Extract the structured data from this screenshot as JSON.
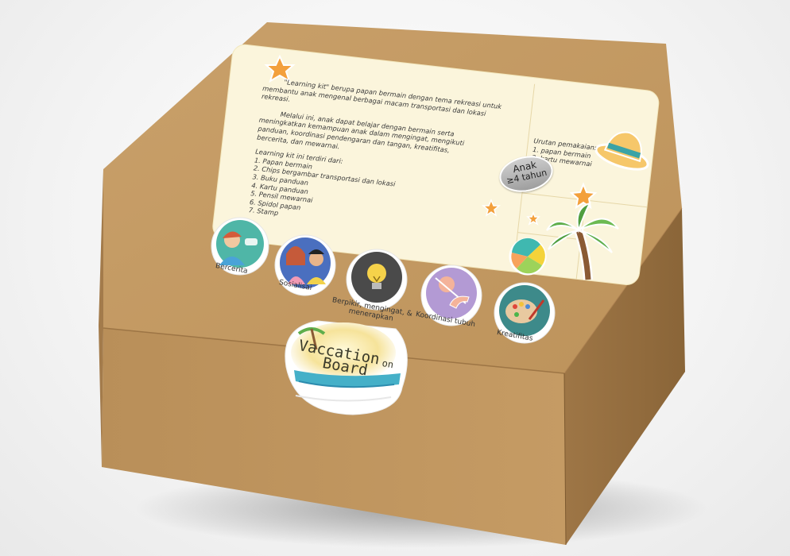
{
  "info_card": {
    "paragraph_1": [
      "\"Learning kit\" berupa papan bermain dengan tema rekreasi untuk",
      "membantu anak mengenal berbagai macam transportasi dan lokasi",
      "rekreasi."
    ],
    "paragraph_2": [
      "Melalui ini, anak dapat belajar dengan bermain serta",
      "meningkatkan kemampuan anak dalam mengingat, mengikuti",
      "panduan, koordinasi pendengaran dan tangan, kreatifitas,",
      "bercerita, dan mewarnai."
    ],
    "list_title": "Learning kit ini terdiri dari:",
    "list_items": [
      "1. Papan bermain",
      "2. Chips bergambar transportasi dan lokasi",
      "3. Buku panduan",
      "4. Kartu panduan",
      "5. Pensil mewarnai",
      "6. Spidol papan",
      "7. Stamp"
    ],
    "usage_title": "Urutan pemakaian:",
    "usage_items": [
      "1. papan bermain",
      "2. kartu mewarnai"
    ],
    "age_line1": "Anak",
    "age_line2": "≥4 tahun"
  },
  "skills": [
    {
      "label": "Bercerita",
      "icon": "storytelling-icon"
    },
    {
      "label": "Sosialisai",
      "icon": "socializing-icon"
    },
    {
      "label": "Berpikir, mengingat, & menerapkan",
      "icon": "lightbulb-icon"
    },
    {
      "label": "Koordinasi tubuh",
      "icon": "hand-coordination-icon"
    },
    {
      "label": "Kreatifitas",
      "icon": "palette-icon"
    }
  ],
  "logo": {
    "word1": "Vaccation",
    "word2": "on",
    "word3": "Board"
  },
  "colors": {
    "cardboard": "#c49a62",
    "card_bg": "#fbf5dc",
    "star": "#f3a03c"
  }
}
